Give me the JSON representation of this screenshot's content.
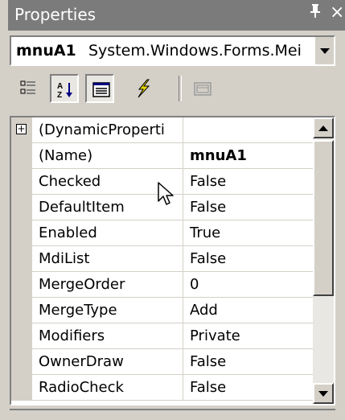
{
  "window": {
    "title": "Properties",
    "pin_glyph": "P",
    "close_glyph": "×"
  },
  "object_selector": {
    "name": "mnuA1",
    "type": "System.Windows.Forms.Mei"
  },
  "toolbar": {
    "buttons": [
      {
        "icon": "categorized-icon",
        "pressed": false
      },
      {
        "icon": "alphabetical-icon",
        "pressed": true
      },
      {
        "icon": "properties-icon",
        "pressed": true
      },
      {
        "icon": "events-icon",
        "pressed": false
      },
      {
        "icon": "property-pages-icon",
        "pressed": false
      }
    ]
  },
  "properties": [
    {
      "name": "(DynamicProperti",
      "value": "",
      "expandable": true
    },
    {
      "name": "(Name)",
      "value": "mnuA1",
      "bold": true
    },
    {
      "name": "Checked",
      "value": "False"
    },
    {
      "name": "DefaultItem",
      "value": "False"
    },
    {
      "name": "Enabled",
      "value": "True"
    },
    {
      "name": "MdiList",
      "value": "False"
    },
    {
      "name": "MergeOrder",
      "value": "0"
    },
    {
      "name": "MergeType",
      "value": "Add"
    },
    {
      "name": "Modifiers",
      "value": "Private"
    },
    {
      "name": "OwnerDraw",
      "value": "False"
    },
    {
      "name": "RadioCheck",
      "value": "False"
    }
  ],
  "colors": {
    "titlebar": "#7b7b7b",
    "face": "#d4d0c8",
    "events_icon": "#e8d800"
  }
}
